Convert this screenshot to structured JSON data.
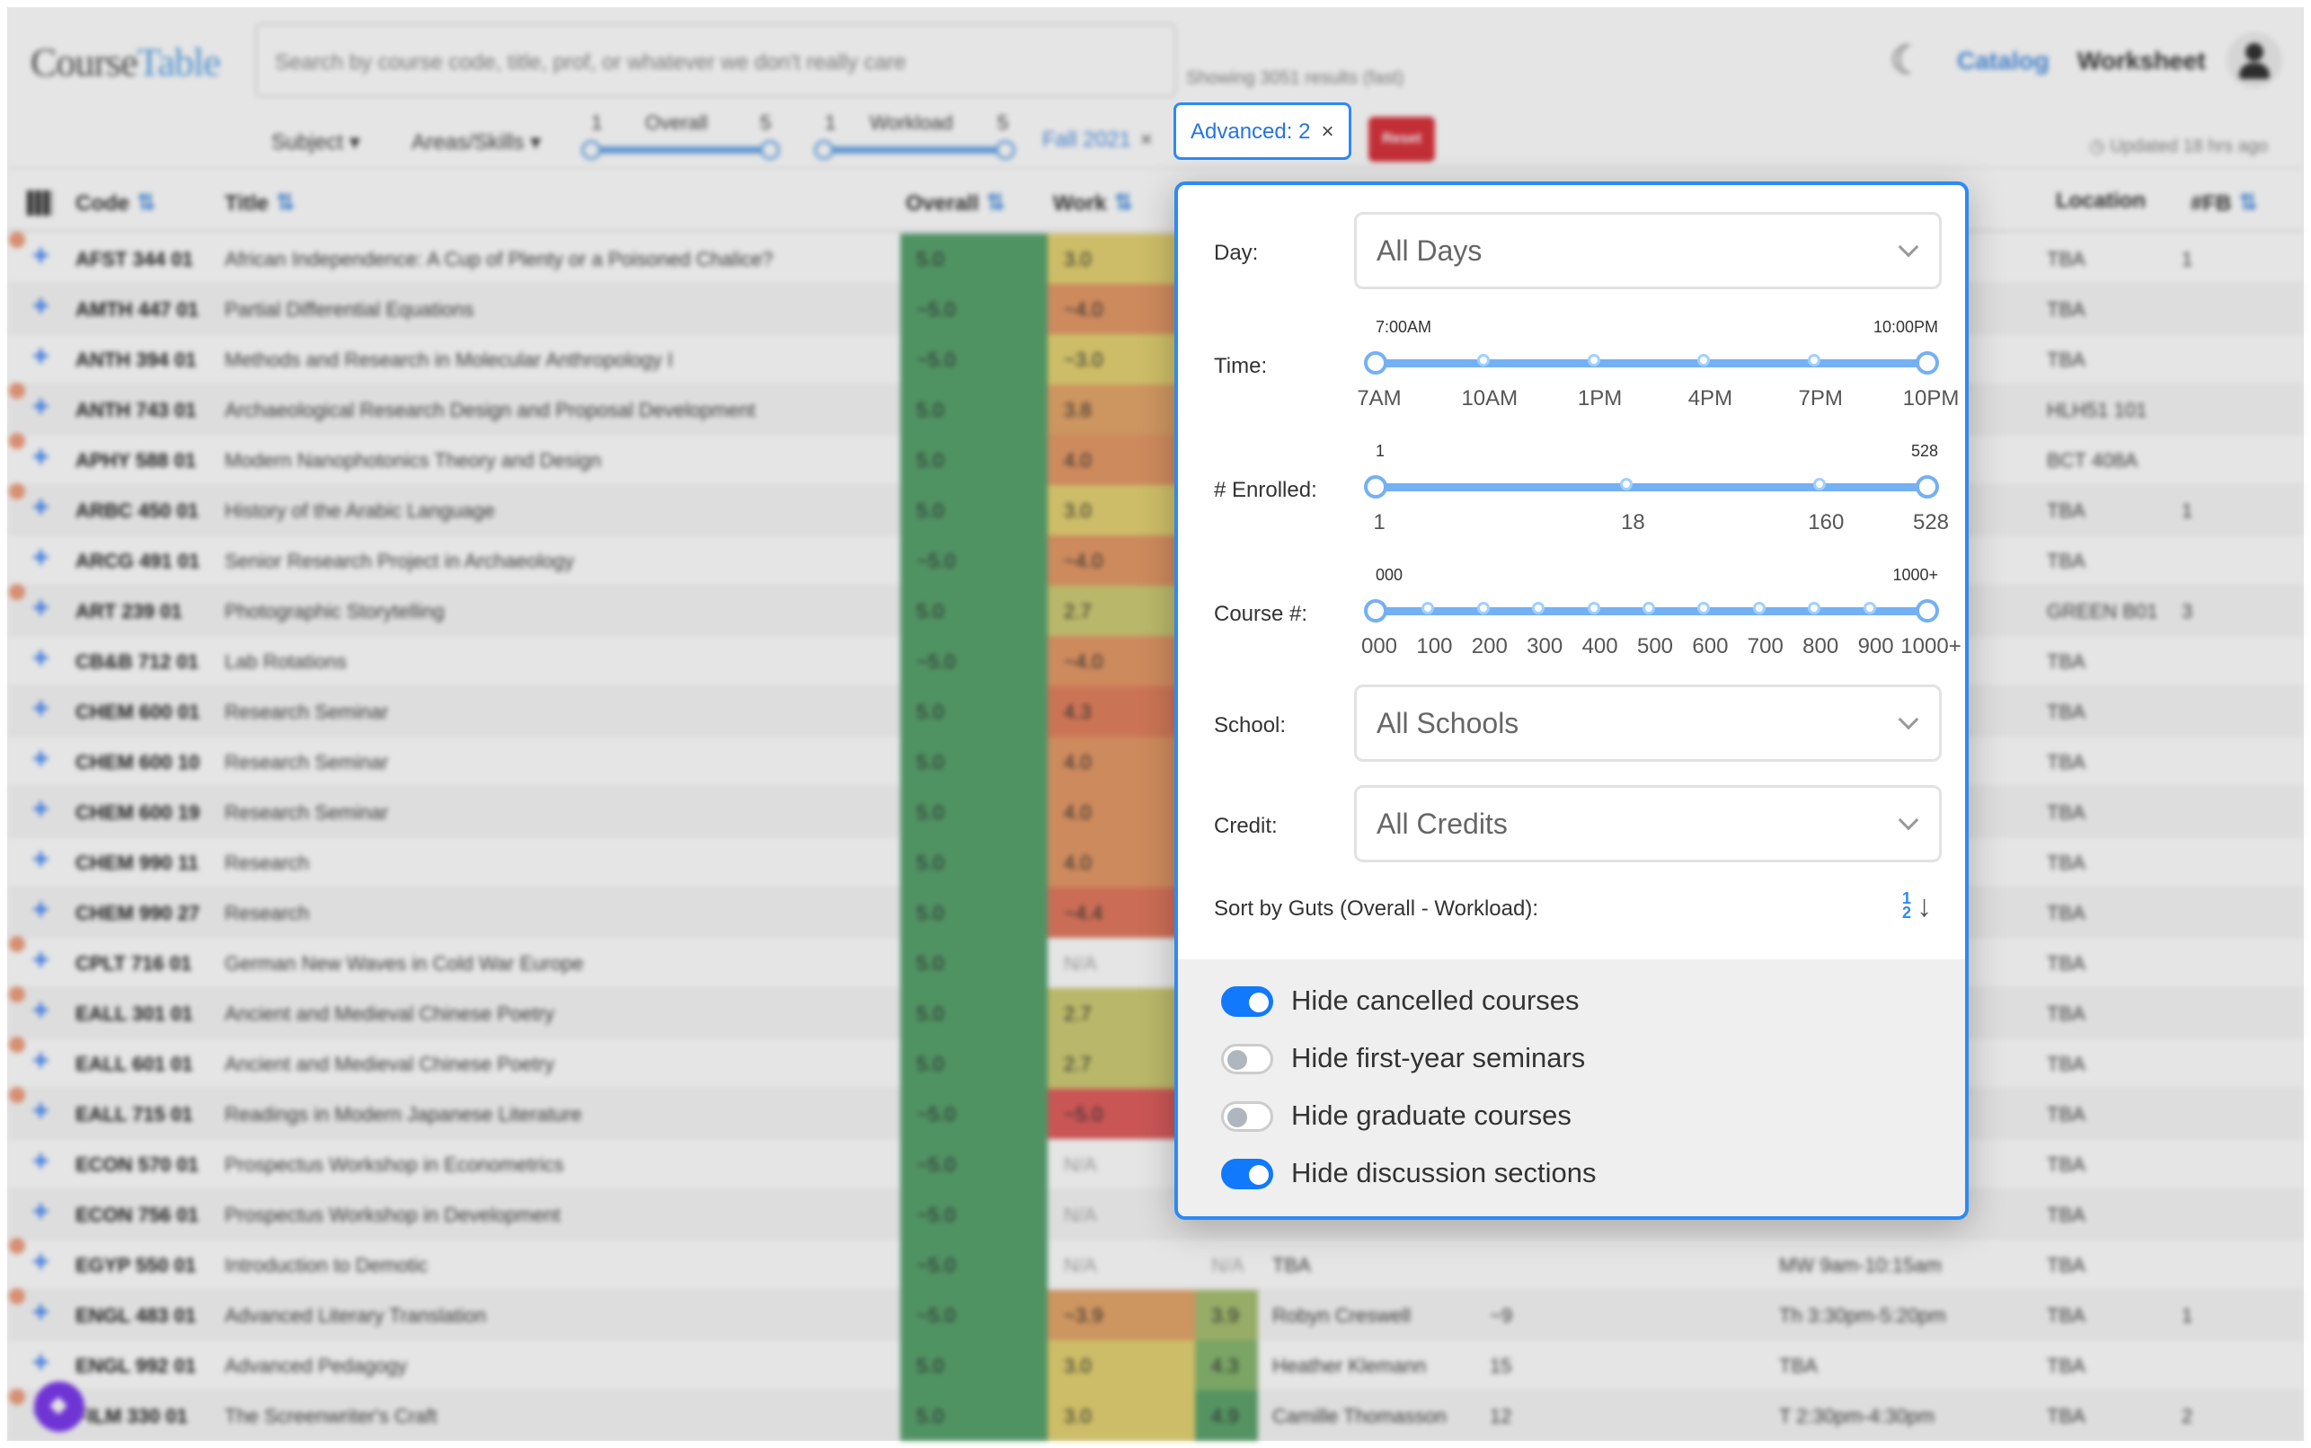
{
  "navbar": {
    "logo_part1": "Course",
    "logo_part2": "Table",
    "search_placeholder": "Search by course code, title, prof, or whatever we don't really care",
    "showing": "Showing 3051 results (fast)",
    "nav_catalog": "Catalog",
    "nav_worksheet": "Worksheet",
    "updated": "Updated 18 hrs ago"
  },
  "filters": {
    "subject": "Subject ▾",
    "areas": "Areas/Skills ▾",
    "overall": {
      "label": "Overall",
      "min": "1",
      "max": "5"
    },
    "workload": {
      "label": "Workload",
      "min": "1",
      "max": "5"
    },
    "season": "Fall 2021",
    "season_remove": "×",
    "advanced": "Advanced: 2",
    "advanced_remove": "×",
    "reset": "Reset"
  },
  "table": {
    "headers": {
      "code": "Code",
      "title": "Title",
      "overall": "Overall",
      "work": "Work",
      "location": "Location",
      "fb": "#FB",
      "sort_glyph": "⇅"
    },
    "rows": [
      {
        "code": "AFST 344 01",
        "title": "African Independence: A Cup of Plenty or a Poisoned Chalice?",
        "overall": "5.0",
        "work": "3.0",
        "work_color": "#e5d374",
        "location": "TBA",
        "fb": "1",
        "dot": true
      },
      {
        "code": "AMTH 447 01",
        "title": "Partial Differential Equations",
        "overall": "~5.0",
        "work": "~4.0",
        "work_color": "#e59a68",
        "location": "TBA",
        "fb": "",
        "dot": false
      },
      {
        "code": "ANTH 394 01",
        "title": "Methods and Research in Molecular Anthropology I",
        "overall": "~5.0",
        "work": "~3.0",
        "work_color": "#e5d374",
        "location": "TBA",
        "fb": "",
        "dot": false
      },
      {
        "code": "ANTH 743 01",
        "title": "Archaeological Research Design and Proposal Development",
        "overall": "5.0",
        "work": "3.8",
        "work_color": "#e5a66b",
        "location": "HLH51 101",
        "fb": "",
        "dot": true
      },
      {
        "code": "APHY 588 01",
        "title": "Modern Nanophotonics Theory and Design",
        "overall": "5.0",
        "work": "4.0",
        "work_color": "#e59a68",
        "location": "BCT 408A",
        "fb": "",
        "dot": true
      },
      {
        "code": "ARBC 450 01",
        "title": "History of the Arabic Language",
        "overall": "5.0",
        "work": "3.0",
        "work_color": "#e5d374",
        "location": "TBA",
        "fb": "1",
        "dot": true
      },
      {
        "code": "ARCG 491 01",
        "title": "Senior Research Project in Archaeology",
        "overall": "~5.0",
        "work": "~4.0",
        "work_color": "#e59a68",
        "location": "TBA",
        "fb": "",
        "dot": false
      },
      {
        "code": "ART 239 01",
        "title": "Photographic Storytelling",
        "overall": "5.0",
        "work": "2.7",
        "work_color": "#cfcd76",
        "location": "GREEN B01",
        "fb": "3",
        "dot": true
      },
      {
        "code": "CB&B 712 01",
        "title": "Lab Rotations",
        "overall": "~5.0",
        "work": "~4.0",
        "work_color": "#e59a68",
        "location": "TBA",
        "fb": "",
        "dot": false
      },
      {
        "code": "CHEM 600 01",
        "title": "Research Seminar",
        "overall": "5.0",
        "work": "4.3",
        "work_color": "#e2825f",
        "location": "TBA",
        "fb": "",
        "dot": false
      },
      {
        "code": "CHEM 600 10",
        "title": "Research Seminar",
        "overall": "5.0",
        "work": "4.0",
        "work_color": "#e59a68",
        "location": "TBA",
        "fb": "",
        "dot": false
      },
      {
        "code": "CHEM 600 19",
        "title": "Research Seminar",
        "overall": "5.0",
        "work": "4.0",
        "work_color": "#e59a68",
        "location": "TBA",
        "fb": "",
        "dot": false
      },
      {
        "code": "CHEM 990 11",
        "title": "Research",
        "overall": "5.0",
        "work": "4.0",
        "work_color": "#e59a68",
        "location": "TBA",
        "fb": "",
        "dot": false
      },
      {
        "code": "CHEM 990 27",
        "title": "Research",
        "overall": "5.0",
        "work": "~4.4",
        "work_color": "#e27a60",
        "location": "TBA",
        "fb": "",
        "dot": false
      },
      {
        "code": "CPLT 716 01",
        "title": "German New Waves in Cold War Europe",
        "overall": "5.0",
        "work": "N/A",
        "work_color": "",
        "location": "TBA",
        "fb": "",
        "dot": true
      },
      {
        "code": "EALL 301 01",
        "title": "Ancient and Medieval Chinese Poetry",
        "overall": "5.0",
        "work": "2.7",
        "work_color": "#cfcd76",
        "location": "TBA",
        "fb": "",
        "dot": true
      },
      {
        "code": "EALL 601 01",
        "title": "Ancient and Medieval Chinese Poetry",
        "overall": "5.0",
        "work": "2.7",
        "work_color": "#cfcd76",
        "location": "TBA",
        "fb": "",
        "dot": true
      },
      {
        "code": "EALL 715 01",
        "title": "Readings in Modern Japanese Literature",
        "overall": "~5.0",
        "work": "~5.0",
        "work_color": "#e0605f",
        "location": "TBA",
        "fb": "",
        "dot": true
      },
      {
        "code": "ECON 570 01",
        "title": "Prospectus Workshop in Econometrics",
        "overall": "~5.0",
        "work": "N/A",
        "work_color": "",
        "location": "TBA",
        "fb": "",
        "dot": false
      },
      {
        "code": "ECON 756 01",
        "title": "Prospectus Workshop in Development",
        "overall": "~5.0",
        "work": "N/A",
        "work_color": "",
        "location": "TBA",
        "fb": "",
        "dot": false
      },
      {
        "code": "EGYP 550 01",
        "title": "Introduction to Demotic",
        "overall": "~5.0",
        "work": "N/A",
        "work_color": "",
        "professor_rating": "N/A",
        "professor_color": "",
        "professor": "TBA",
        "enrolled": "",
        "meets": "MW 9am-10:15am",
        "location": "TBA",
        "fb": "",
        "dot": true
      },
      {
        "code": "ENGL 483 01",
        "title": "Advanced Literary Translation",
        "overall": "~5.0",
        "work": "~3.9",
        "work_color": "#e5a66b",
        "professor_rating": "3.9",
        "professor_color": "#a8c073",
        "professor": "Robyn Creswell",
        "enrolled": "~9",
        "meets": "Th 3:30pm-5:20pm",
        "location": "TBA",
        "fb": "1",
        "dot": true
      },
      {
        "code": "ENGL 992 01",
        "title": "Advanced Pedagogy",
        "overall": "5.0",
        "work": "3.0",
        "work_color": "#e5d374",
        "professor_rating": "4.3",
        "professor_color": "#88b870",
        "professor": "Heather Klemann",
        "enrolled": "15",
        "meets": "TBA",
        "location": "TBA",
        "fb": "",
        "dot": false
      },
      {
        "code": "FILM 330 01",
        "title": "The Screenwriter's Craft",
        "overall": "5.0",
        "work": "3.0",
        "work_color": "#e5d374",
        "professor_rating": "4.9",
        "professor_color": "#5fa56e",
        "professor": "Camille Thomasson",
        "enrolled": "12",
        "meets": "T 2:30pm-4:30pm",
        "location": "TBA",
        "fb": "2",
        "dot": true
      }
    ]
  },
  "colors": {
    "accent": "#2d8af5",
    "overall_green": "#5aa46f",
    "reset_red": "#d9343d",
    "toggle_on": "#1179fb"
  },
  "advanced_panel": {
    "day": {
      "label": "Day:",
      "value": "All Days"
    },
    "time": {
      "label": "Time:",
      "min_value": "7:00AM",
      "max_value": "10:00PM",
      "marks": [
        "7AM",
        "10AM",
        "1PM",
        "4PM",
        "7PM",
        "10PM"
      ],
      "range": [
        0,
        1
      ]
    },
    "enrolled": {
      "label": "# Enrolled:",
      "min_value": "1",
      "max_value": "528",
      "marks": [
        "1",
        "18",
        "160",
        "528"
      ],
      "mark_positions": [
        0,
        0.46,
        0.81,
        1
      ],
      "range": [
        0,
        1
      ]
    },
    "course_num": {
      "label": "Course #:",
      "min_value": "000",
      "max_value": "1000+",
      "marks": [
        "000",
        "100",
        "200",
        "300",
        "400",
        "500",
        "600",
        "700",
        "800",
        "900",
        "1000+"
      ],
      "range": [
        0,
        1
      ]
    },
    "school": {
      "label": "School:",
      "value": "All Schools"
    },
    "credit": {
      "label": "Credit:",
      "value": "All Credits"
    },
    "guts": {
      "label": "Sort by Guts  (Overall - Workload):",
      "icon_top": "1",
      "icon_bottom": "2",
      "icon_arrow": "↓"
    },
    "toggles": [
      {
        "label": "Hide cancelled courses",
        "on": true
      },
      {
        "label": "Hide first-year seminars",
        "on": false
      },
      {
        "label": "Hide graduate courses",
        "on": false
      },
      {
        "label": "Hide discussion sections",
        "on": true
      }
    ]
  }
}
